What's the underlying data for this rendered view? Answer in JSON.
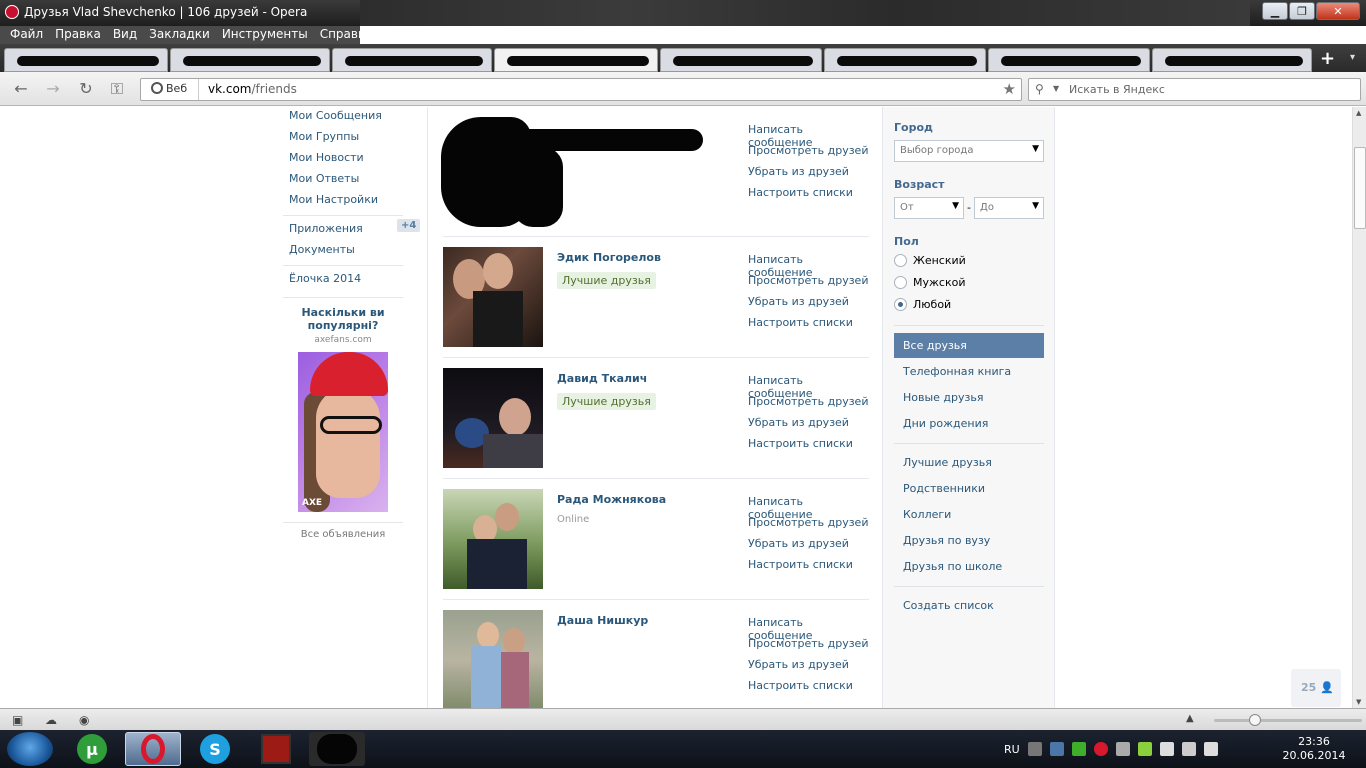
{
  "window": {
    "title": "Друзья Vlad Shevchenko | 106 друзей - Opera",
    "minimize": "▁",
    "maximize": "❐",
    "close": "✕"
  },
  "menu": [
    "Файл",
    "Правка",
    "Вид",
    "Закладки",
    "Инструменты",
    "Справка"
  ],
  "tabs": {
    "new_tab": "+",
    "list": "▾"
  },
  "addressbar": {
    "web_label": "Веб",
    "url_host": "vk.com",
    "url_path": "/friends",
    "search_placeholder": "Искать в Яндекс"
  },
  "left_nav": {
    "items": [
      "Мои Сообщения",
      "Мои Группы",
      "Мои Новости",
      "Мои Ответы",
      "Мои Настройки"
    ],
    "apps": "Приложения",
    "apps_badge": "+4",
    "docs": "Документы",
    "elochka": "Ёлочка 2014"
  },
  "ad": {
    "title": "Наскільки ви популярні?",
    "domain": "axefans.com",
    "brand": "AXE",
    "all_ads": "Все объявления"
  },
  "friend_actions": [
    "Написать сообщение",
    "Просмотреть друзей",
    "Убрать из друзей",
    "Настроить списки"
  ],
  "friends": [
    {
      "name": "",
      "tag": "",
      "status": ""
    },
    {
      "name": "Эдик Погорелов",
      "tag": "Лучшие друзья",
      "status": ""
    },
    {
      "name": "Давид Ткалич",
      "tag": "Лучшие друзья",
      "status": ""
    },
    {
      "name": "Рада Можнякова",
      "tag": "",
      "status": "Online"
    },
    {
      "name": "Даша Нишкур",
      "tag": "",
      "status": ""
    }
  ],
  "filters": {
    "city_label": "Город",
    "city_select": "Выбор города",
    "age_label": "Возраст",
    "age_from": "От",
    "age_dash": "-",
    "age_to": "До",
    "sex_label": "Пол",
    "sex_options": [
      "Женский",
      "Мужской",
      "Любой"
    ],
    "sex_selected": 2
  },
  "friend_lists": {
    "main": [
      "Все друзья",
      "Телефонная книга",
      "Новые друзья",
      "Дни рождения"
    ],
    "groups": [
      "Лучшие друзья",
      "Родственники",
      "Коллеги",
      "Друзья по вузу",
      "Друзья по школе"
    ],
    "create": "Создать список"
  },
  "online_counter": "25",
  "taskbar": {
    "lang": "RU",
    "time": "23:36",
    "date": "20.06.2014"
  },
  "colors": {
    "link": "#2b587a",
    "active_list_bg": "#5b7fa6",
    "best_friends_tag_bg": "#e8f2e2"
  }
}
